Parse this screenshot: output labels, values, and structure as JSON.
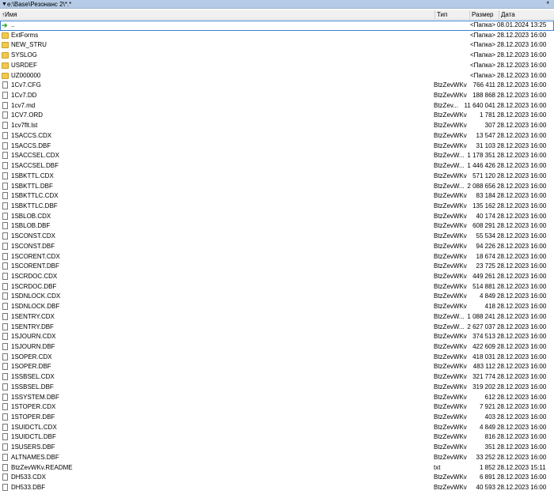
{
  "path_bar": {
    "path": "e:\\Base\\Резонанс 2\\*.*",
    "star": "*"
  },
  "columns": {
    "name": "Имя",
    "type": "Тип",
    "size": "Размер",
    "date": "Дата"
  },
  "rows": [
    {
      "icon": "up",
      "name": "..",
      "type": "",
      "size": "<Папка>",
      "date": "08.01.2024 13:25"
    },
    {
      "icon": "folder",
      "name": "ExtForms",
      "type": "",
      "size": "<Папка>",
      "date": "28.12.2023 16:00"
    },
    {
      "icon": "folder",
      "name": "NEW_STRU",
      "type": "",
      "size": "<Папка>",
      "date": "28.12.2023 16:00"
    },
    {
      "icon": "folder",
      "name": "SYSLOG",
      "type": "",
      "size": "<Папка>",
      "date": "28.12.2023 16:00"
    },
    {
      "icon": "folder",
      "name": "USRDEF",
      "type": "",
      "size": "<Папка>",
      "date": "28.12.2023 16:00"
    },
    {
      "icon": "folder",
      "name": "UZ000000",
      "type": "",
      "size": "<Папка>",
      "date": "28.12.2023 16:00"
    },
    {
      "icon": "file",
      "name": "1Cv7.CFG",
      "type": "BtzZevWKv",
      "size": "766 411",
      "date": "28.12.2023 16:00"
    },
    {
      "icon": "file",
      "name": "1Cv7.DD",
      "type": "BtzZevWKv",
      "size": "188 868",
      "date": "28.12.2023 16:00"
    },
    {
      "icon": "file",
      "name": "1cv7.md",
      "type": "BtzZev...",
      "size": "11 640 041",
      "date": "28.12.2023 16:00"
    },
    {
      "icon": "file",
      "name": "1CV7.ORD",
      "type": "BtzZevWKv",
      "size": "1 781",
      "date": "28.12.2023 16:00"
    },
    {
      "icon": "file",
      "name": "1cv7flt.lst",
      "type": "BtzZevWKv",
      "size": "307",
      "date": "28.12.2023 16:00"
    },
    {
      "icon": "file",
      "name": "1SACCS.CDX",
      "type": "BtzZevWKv",
      "size": "13 547",
      "date": "28.12.2023 16:00"
    },
    {
      "icon": "file",
      "name": "1SACCS.DBF",
      "type": "BtzZevWKv",
      "size": "31 103",
      "date": "28.12.2023 16:00"
    },
    {
      "icon": "file",
      "name": "1SACCSEL.CDX",
      "type": "BtzZevW...",
      "size": "1 178 351",
      "date": "28.12.2023 16:00"
    },
    {
      "icon": "file",
      "name": "1SACCSEL.DBF",
      "type": "BtzZevW...",
      "size": "1 446 426",
      "date": "28.12.2023 16:00"
    },
    {
      "icon": "file",
      "name": "1SBKTTL.CDX",
      "type": "BtzZevWKv",
      "size": "571 120",
      "date": "28.12.2023 16:00"
    },
    {
      "icon": "file",
      "name": "1SBKTTL.DBF",
      "type": "BtzZevW...",
      "size": "2 088 656",
      "date": "28.12.2023 16:00"
    },
    {
      "icon": "file",
      "name": "1SBKTTLC.CDX",
      "type": "BtzZevWKv",
      "size": "83 184",
      "date": "28.12.2023 16:00"
    },
    {
      "icon": "file",
      "name": "1SBKTTLC.DBF",
      "type": "BtzZevWKv",
      "size": "135 162",
      "date": "28.12.2023 16:00"
    },
    {
      "icon": "file",
      "name": "1SBLOB.CDX",
      "type": "BtzZevWKv",
      "size": "40 174",
      "date": "28.12.2023 16:00"
    },
    {
      "icon": "file",
      "name": "1SBLOB.DBF",
      "type": "BtzZevWKv",
      "size": "608 291",
      "date": "28.12.2023 16:00"
    },
    {
      "icon": "file",
      "name": "1SCONST.CDX",
      "type": "BtzZevWKv",
      "size": "55 534",
      "date": "28.12.2023 16:00"
    },
    {
      "icon": "file",
      "name": "1SCONST.DBF",
      "type": "BtzZevWKv",
      "size": "94 226",
      "date": "28.12.2023 16:00"
    },
    {
      "icon": "file",
      "name": "1SCORENT.CDX",
      "type": "BtzZevWKv",
      "size": "18 674",
      "date": "28.12.2023 16:00"
    },
    {
      "icon": "file",
      "name": "1SCORENT.DBF",
      "type": "BtzZevWKv",
      "size": "23 725",
      "date": "28.12.2023 16:00"
    },
    {
      "icon": "file",
      "name": "1SCRDOC.CDX",
      "type": "BtzZevWKv",
      "size": "449 261",
      "date": "28.12.2023 16:00"
    },
    {
      "icon": "file",
      "name": "1SCRDOC.DBF",
      "type": "BtzZevWKv",
      "size": "514 881",
      "date": "28.12.2023 16:00"
    },
    {
      "icon": "file",
      "name": "1SDNLOCK.CDX",
      "type": "BtzZevWKv",
      "size": "4 849",
      "date": "28.12.2023 16:00"
    },
    {
      "icon": "file",
      "name": "1SDNLOCK.DBF",
      "type": "BtzZevWKv",
      "size": "418",
      "date": "28.12.2023 16:00"
    },
    {
      "icon": "file",
      "name": "1SENTRY.CDX",
      "type": "BtzZevW...",
      "size": "1 088 241",
      "date": "28.12.2023 16:00"
    },
    {
      "icon": "file",
      "name": "1SENTRY.DBF",
      "type": "BtzZevW...",
      "size": "2 627 037",
      "date": "28.12.2023 16:00"
    },
    {
      "icon": "file",
      "name": "1SJOURN.CDX",
      "type": "BtzZevWKv",
      "size": "374 513",
      "date": "28.12.2023 16:00"
    },
    {
      "icon": "file",
      "name": "1SJOURN.DBF",
      "type": "BtzZevWKv",
      "size": "422 609",
      "date": "28.12.2023 16:00"
    },
    {
      "icon": "file",
      "name": "1SOPER.CDX",
      "type": "BtzZevWKv",
      "size": "418 031",
      "date": "28.12.2023 16:00"
    },
    {
      "icon": "file",
      "name": "1SOPER.DBF",
      "type": "BtzZevWKv",
      "size": "483 112",
      "date": "28.12.2023 16:00"
    },
    {
      "icon": "file",
      "name": "1SSBSEL.CDX",
      "type": "BtzZevWKv",
      "size": "321 774",
      "date": "28.12.2023 16:00"
    },
    {
      "icon": "file",
      "name": "1SSBSEL.DBF",
      "type": "BtzZevWKv",
      "size": "319 202",
      "date": "28.12.2023 16:00"
    },
    {
      "icon": "file",
      "name": "1SSYSTEM.DBF",
      "type": "BtzZevWKv",
      "size": "612",
      "date": "28.12.2023 16:00"
    },
    {
      "icon": "file",
      "name": "1STOPER.CDX",
      "type": "BtzZevWKv",
      "size": "7 921",
      "date": "28.12.2023 16:00"
    },
    {
      "icon": "file",
      "name": "1STOPER.DBF",
      "type": "BtzZevWKv",
      "size": "403",
      "date": "28.12.2023 16:00"
    },
    {
      "icon": "file",
      "name": "1SUIDCTL.CDX",
      "type": "BtzZevWKv",
      "size": "4 849",
      "date": "28.12.2023 16:00"
    },
    {
      "icon": "file",
      "name": "1SUIDCTL.DBF",
      "type": "BtzZevWKv",
      "size": "816",
      "date": "28.12.2023 16:00"
    },
    {
      "icon": "file",
      "name": "1SUSERS.DBF",
      "type": "BtzZevWKv",
      "size": "351",
      "date": "28.12.2023 16:00"
    },
    {
      "icon": "file",
      "name": "ALTNAMES.DBF",
      "type": "BtzZevWKv",
      "size": "33 252",
      "date": "28.12.2023 16:00"
    },
    {
      "icon": "file",
      "name": "BtzZevWKv.README",
      "type": "txt",
      "size": "1 852",
      "date": "28.12.2023 15:11"
    },
    {
      "icon": "file",
      "name": "DH533.CDX",
      "type": "BtzZevWKv",
      "size": "6 891",
      "date": "28.12.2023 16:00"
    },
    {
      "icon": "file",
      "name": "DH533.DBF",
      "type": "BtzZevWKv",
      "size": "40 593",
      "date": "28.12.2023 16:00"
    }
  ]
}
